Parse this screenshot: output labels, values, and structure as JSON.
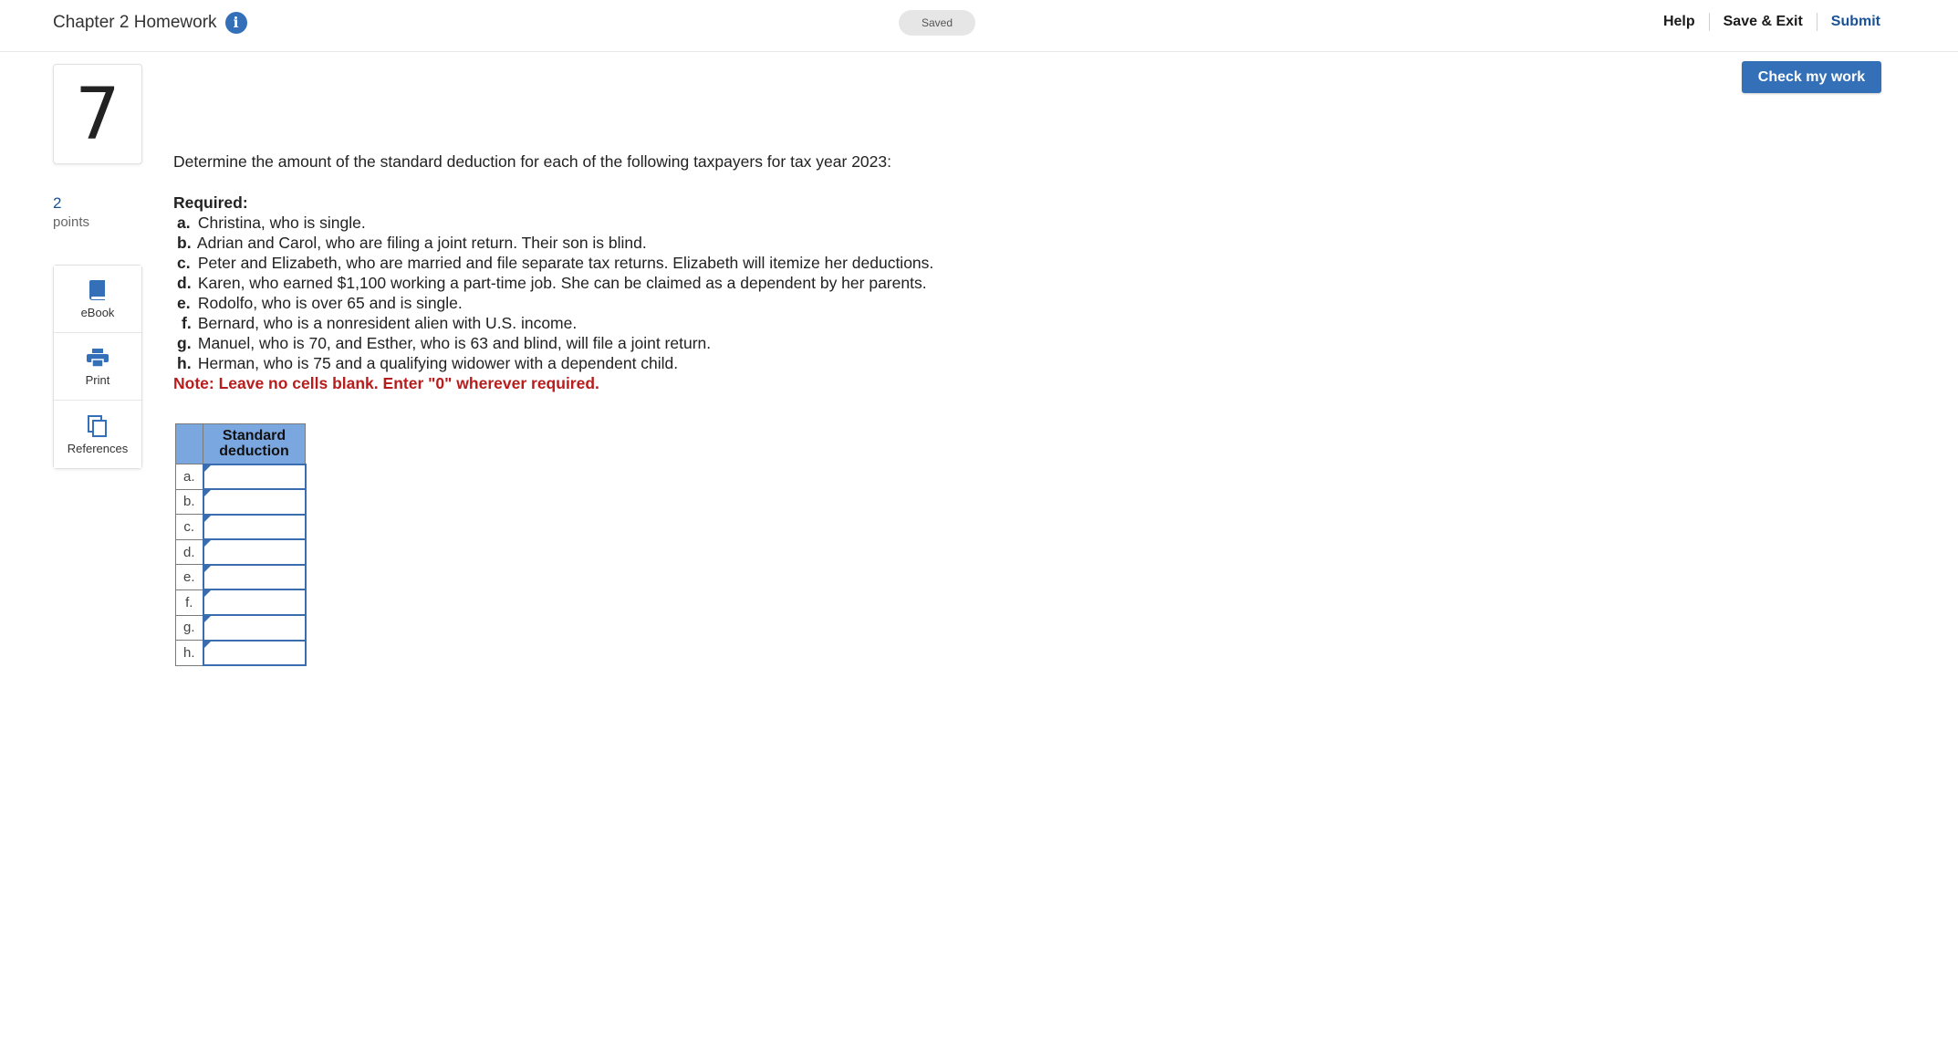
{
  "header": {
    "assignment_title": "Chapter 2 Homework",
    "info_icon": "info-icon",
    "saved_status": "Saved",
    "help_label": "Help",
    "save_exit_label": "Save & Exit",
    "submit_label": "Submit"
  },
  "question": {
    "number": "7",
    "points_value": "2",
    "points_label": "points",
    "check_my_work_label": "Check my work",
    "prompt": "Determine the amount of the standard deduction for each of the following taxpayers for tax year 2023:",
    "required_label": "Required:",
    "parts": [
      {
        "letter": "a.",
        "text": "Christina, who is single."
      },
      {
        "letter": "b.",
        "text": "Adrian and Carol, who are filing a joint return. Their son is blind."
      },
      {
        "letter": "c.",
        "text": "Peter and Elizabeth, who are married and file separate tax returns. Elizabeth will itemize her deductions."
      },
      {
        "letter": "d.",
        "text": "Karen, who earned $1,100 working a part-time job. She can be claimed as a dependent by her parents."
      },
      {
        "letter": "e.",
        "text": "Rodolfo, who is over 65 and is single."
      },
      {
        "letter": "f.",
        "text": "Bernard, who is a nonresident alien with U.S. income."
      },
      {
        "letter": "g.",
        "text": "Manuel, who is 70, and Esther, who is 63 and blind, will file a joint return."
      },
      {
        "letter": "h.",
        "text": "Herman, who is 75 and a qualifying widower with a dependent child."
      }
    ],
    "note": "Note: Leave no cells blank. Enter \"0\" wherever required."
  },
  "tools": [
    {
      "label": "eBook",
      "icon": "book-icon"
    },
    {
      "label": "Print",
      "icon": "printer-icon"
    },
    {
      "label": "References",
      "icon": "references-icon"
    }
  ],
  "answer_table": {
    "column_header": "Standard deduction",
    "rows": [
      {
        "label": "a.",
        "value": ""
      },
      {
        "label": "b.",
        "value": ""
      },
      {
        "label": "c.",
        "value": ""
      },
      {
        "label": "d.",
        "value": ""
      },
      {
        "label": "e.",
        "value": ""
      },
      {
        "label": "f.",
        "value": ""
      },
      {
        "label": "g.",
        "value": ""
      },
      {
        "label": "h.",
        "value": ""
      }
    ]
  },
  "colors": {
    "accent": "#3470b8",
    "note_red": "#b81d1d",
    "table_header": "#7ba7e0"
  }
}
